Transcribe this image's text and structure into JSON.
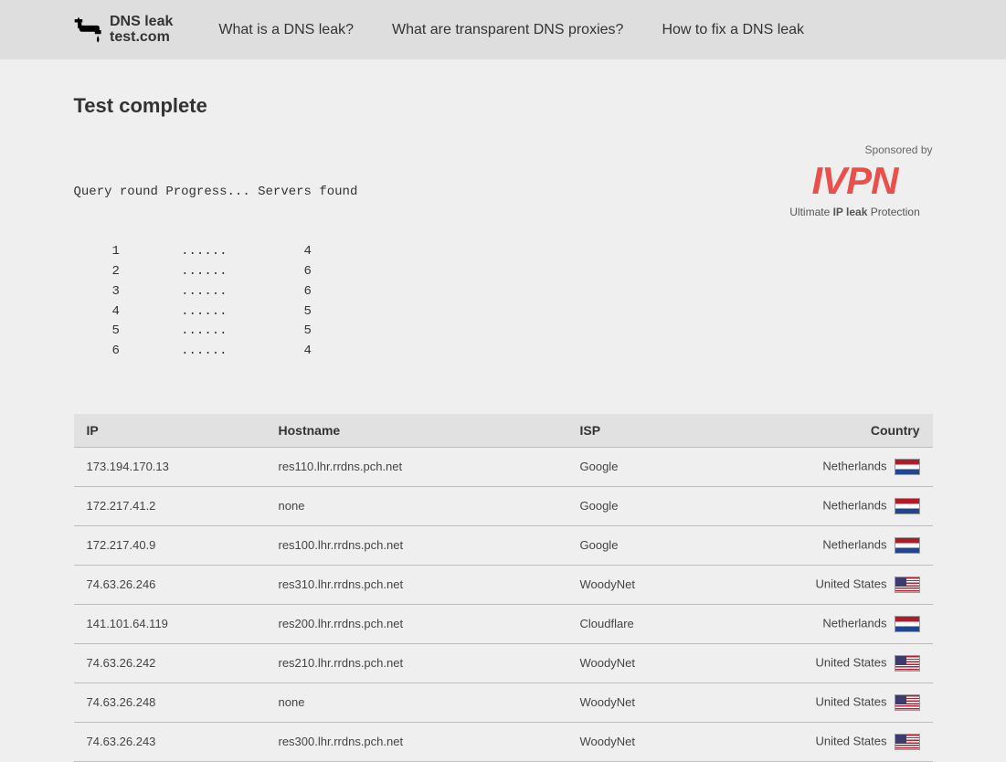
{
  "header": {
    "brand_line1": "DNS leak",
    "brand_line2": "test.com",
    "nav": [
      "What is a DNS leak?",
      "What are transparent DNS proxies?",
      "How to fix a DNS leak"
    ]
  },
  "page": {
    "title": "Test complete"
  },
  "progress": {
    "header": "Query round Progress... Servers found",
    "rows": [
      {
        "round": "1",
        "progress": "......",
        "servers": "4"
      },
      {
        "round": "2",
        "progress": "......",
        "servers": "6"
      },
      {
        "round": "3",
        "progress": "......",
        "servers": "6"
      },
      {
        "round": "4",
        "progress": "......",
        "servers": "5"
      },
      {
        "round": "5",
        "progress": "......",
        "servers": "5"
      },
      {
        "round": "6",
        "progress": "......",
        "servers": "4"
      }
    ]
  },
  "sponsor": {
    "label": "Sponsored by",
    "logo_text": "IVPN",
    "tagline_prefix": "Ultimate ",
    "tagline_bold": "IP leak",
    "tagline_suffix": " Protection"
  },
  "table": {
    "headers": [
      "IP",
      "Hostname",
      "ISP",
      "Country"
    ],
    "rows": [
      {
        "ip": "173.194.170.13",
        "hostname": "res110.lhr.rrdns.pch.net",
        "isp": "Google",
        "country": "Netherlands",
        "flag": "nl"
      },
      {
        "ip": "172.217.41.2",
        "hostname": "none",
        "isp": "Google",
        "country": "Netherlands",
        "flag": "nl"
      },
      {
        "ip": "172.217.40.9",
        "hostname": "res100.lhr.rrdns.pch.net",
        "isp": "Google",
        "country": "Netherlands",
        "flag": "nl"
      },
      {
        "ip": "74.63.26.246",
        "hostname": "res310.lhr.rrdns.pch.net",
        "isp": "WoodyNet",
        "country": "United States",
        "flag": "us"
      },
      {
        "ip": "141.101.64.119",
        "hostname": "res200.lhr.rrdns.pch.net",
        "isp": "Cloudflare",
        "country": "Netherlands",
        "flag": "nl"
      },
      {
        "ip": "74.63.26.242",
        "hostname": "res210.lhr.rrdns.pch.net",
        "isp": "WoodyNet",
        "country": "United States",
        "flag": "us"
      },
      {
        "ip": "74.63.26.248",
        "hostname": "none",
        "isp": "WoodyNet",
        "country": "United States",
        "flag": "us"
      },
      {
        "ip": "74.63.26.243",
        "hostname": "res300.lhr.rrdns.pch.net",
        "isp": "WoodyNet",
        "country": "United States",
        "flag": "us"
      }
    ]
  }
}
